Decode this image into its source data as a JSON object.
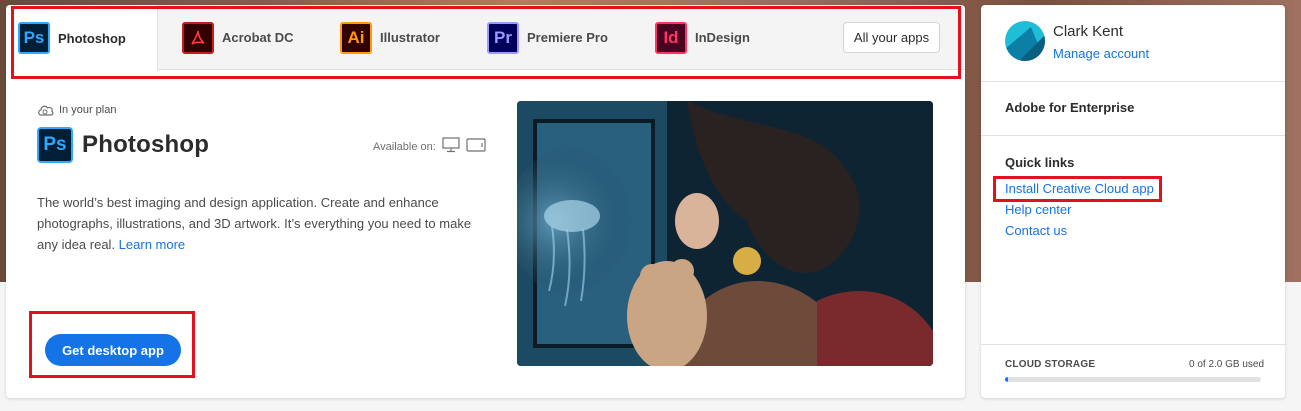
{
  "tabs": [
    {
      "label": "Photoshop",
      "abbr": "Ps",
      "icon": "photoshop-icon",
      "active": true
    },
    {
      "label": "Acrobat DC",
      "abbr": "⅄",
      "icon": "acrobat-icon",
      "active": false
    },
    {
      "label": "Illustrator",
      "abbr": "Ai",
      "icon": "illustrator-icon",
      "active": false
    },
    {
      "label": "Premiere Pro",
      "abbr": "Pr",
      "icon": "premiere-icon",
      "active": false
    },
    {
      "label": "InDesign",
      "abbr": "Id",
      "icon": "indesign-icon",
      "active": false
    }
  ],
  "all_apps_label": "All your apps",
  "product": {
    "plan_label": "In your plan",
    "abbr": "Ps",
    "title": "Photoshop",
    "available_on": "Available on:",
    "description": "The world’s best imaging and design application. Create and enhance photographs, illustrations, and 3D artwork. It’s everything you need to make any idea real.",
    "learn_more": "Learn more",
    "cta": "Get desktop app"
  },
  "account": {
    "name": "Clark Kent",
    "manage": "Manage account"
  },
  "enterprise_label": "Adobe for Enterprise",
  "quick_links": {
    "heading": "Quick links",
    "items": [
      "Install Creative Cloud app",
      "Help center",
      "Contact us"
    ]
  },
  "storage": {
    "label": "CLOUD STORAGE",
    "used_text": "0 of 2.0 GB used",
    "fraction": 0.01
  },
  "colors": {
    "accent": "#1473e6",
    "highlight_box": "#e3101e"
  }
}
